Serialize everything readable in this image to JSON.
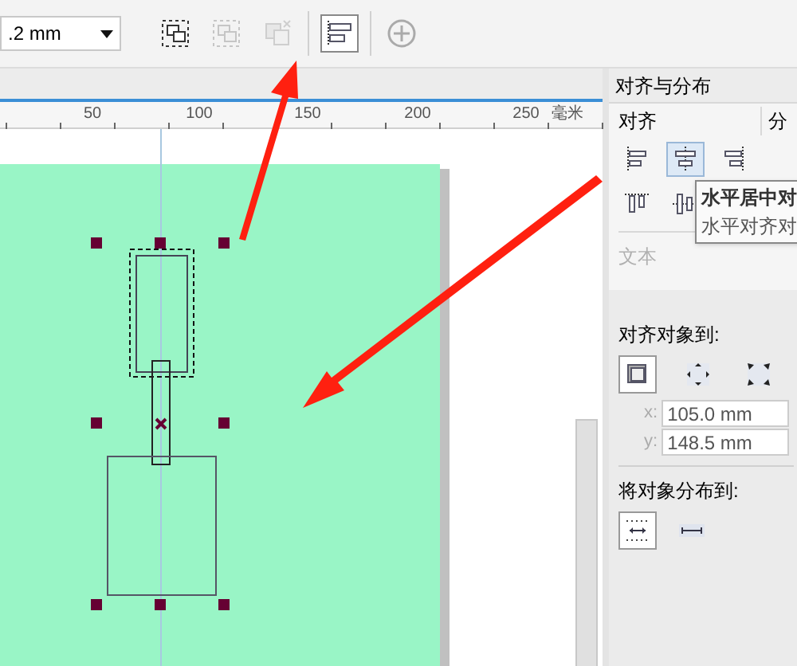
{
  "toolbar": {
    "outline_width": {
      "value": ".2 mm"
    },
    "buttons": [
      {
        "kind": "group",
        "disabled": false
      },
      {
        "kind": "ungroup",
        "disabled": true
      },
      {
        "kind": "ungroup-all",
        "disabled": true
      },
      {
        "kind": "align",
        "disabled": false,
        "selected": true
      },
      {
        "kind": "add",
        "disabled": false
      }
    ]
  },
  "ruler": {
    "labels": [
      "50",
      "100",
      "150",
      "200",
      "250"
    ],
    "unit": "毫米"
  },
  "panel": {
    "title": "对齐与分布",
    "align_heading": "对齐",
    "distribute_heading": "分",
    "align_buttons": [
      {
        "selected": false
      },
      {
        "selected": true
      },
      {
        "selected": false
      },
      {
        "selected": false
      },
      {
        "selected": false
      }
    ],
    "tooltip": {
      "title": "水平居中对",
      "text": "水平对齐对"
    },
    "text_label": {
      "label": "文本",
      "disabled": true
    },
    "align_to": {
      "heading": "对齐对象到:",
      "options": [
        {
          "selected": true
        },
        {
          "selected": false
        },
        {
          "selected": false
        }
      ],
      "x_label": "x:",
      "x": "105.0 mm",
      "y_label": "y:",
      "y": "148.5 mm"
    },
    "distribute_to": {
      "heading": "将对象分布到:",
      "options": [
        {
          "selected": true
        },
        {
          "selected": false
        }
      ]
    }
  }
}
